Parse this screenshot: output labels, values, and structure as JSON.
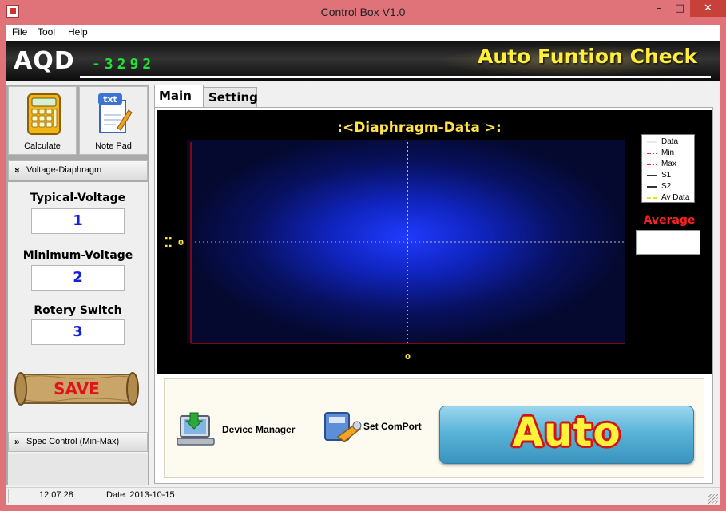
{
  "window": {
    "title": "Control Box V1.0",
    "minimize_glyph": "–",
    "maximize_glyph": "□",
    "close_glyph": "✕"
  },
  "menu": {
    "items": [
      "File",
      "Tool",
      "Help"
    ]
  },
  "banner": {
    "logo": "AQD",
    "code": "-3292",
    "title": "Auto Funtion Check"
  },
  "left_panel": {
    "tools": [
      {
        "label": "Calculate",
        "icon": "calculator-icon"
      },
      {
        "label": "Note Pad",
        "icon": "notepad-icon",
        "icon_text": "txt"
      }
    ],
    "group1": {
      "title": "Voltage-Diaphragm",
      "chevron": "»",
      "fields": [
        {
          "label": "Typical-Voltage",
          "value": "1"
        },
        {
          "label": "Minimum-Voltage",
          "value": "2"
        },
        {
          "label": "Rotery Switch",
          "value": "3"
        }
      ],
      "save_label": "SAVE"
    },
    "group2": {
      "title": "Spec Control (Min-Max)",
      "chevron": "»"
    }
  },
  "tabs": [
    {
      "label": "Main",
      "active": true
    },
    {
      "label": "Setting",
      "active": false
    }
  ],
  "chart_data": {
    "type": "line",
    "title": ":<Diaphragm-Data >:",
    "series": [
      {
        "name": "Data",
        "color": "#ffffff",
        "style": "solid",
        "values": []
      },
      {
        "name": "Min",
        "color": "#ff2020",
        "style": "dotted",
        "values": []
      },
      {
        "name": "Max",
        "color": "#ff2020",
        "style": "dotted",
        "values": []
      },
      {
        "name": "S1",
        "color": "#333333",
        "style": "solid",
        "values": []
      },
      {
        "name": "S2",
        "color": "#333333",
        "style": "solid",
        "values": []
      },
      {
        "name": "Av Data",
        "color": "#e6e600",
        "style": "dashed",
        "values": []
      }
    ],
    "x_tick_labels": [
      "0"
    ],
    "y_tick_labels": [
      "0"
    ],
    "y_axis_marker": ": :",
    "grid": true,
    "legend_position": "top-right",
    "background": "#000000",
    "plot_color": "#1f3bff",
    "axis_color": "#7a0c0c"
  },
  "average": {
    "label": "Average",
    "value": ""
  },
  "actions": {
    "device_manager": "Device Manager",
    "set_comport": "Set ComPort",
    "auto": "Auto"
  },
  "status": {
    "time": "12:07:28",
    "date": "Date: 2013-10-15"
  }
}
